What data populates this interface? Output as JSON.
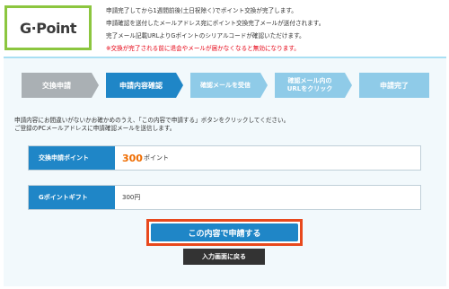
{
  "logo": {
    "text": "G·Point"
  },
  "header": {
    "notes": [
      "申請完了してから1週間前後(土日祝除く)でポイント交換が完了します。",
      "申請確認を送付したメールアドレス宛にポイント交換完了メールが送付されます。",
      "完了メール記載URLよりGポイントのシリアルコードが確認いただけます。"
    ],
    "warning": "※交換が完了される前に退会やメールが届かなくなると無効になります。"
  },
  "steps": [
    {
      "label": "交換申請",
      "state": "done"
    },
    {
      "label": "申請内容確認",
      "state": "current"
    },
    {
      "label": "確認メールを受信",
      "state": "upcoming"
    },
    {
      "label_line1": "確認メール内の",
      "label_line2": "URLをクリック",
      "state": "upcoming"
    },
    {
      "label": "申請完了",
      "state": "upcoming"
    }
  ],
  "instructions": {
    "line1": "申請内容にお間違いがないかお確かめのうえ、「この内容で申請する」ボタンをクリックしてください。",
    "line2": "ご登録のPCメールアドレスに申請確認メールを送信します。"
  },
  "form": {
    "points_label": "交換申請ポイント",
    "points_value": "300",
    "points_unit": "ポイント",
    "gift_label": "Gポイントギフト",
    "gift_value": "300円"
  },
  "buttons": {
    "submit": "この内容で申請する",
    "back": "入力画面に戻る"
  },
  "colors": {
    "accent_blue": "#1f86c7",
    "light_blue": "#8fcbe8",
    "step_grey": "#aab0b4",
    "highlight_red": "#e8491d",
    "points_orange": "#ef6c00",
    "logo_border_green": "#8cc63f"
  }
}
